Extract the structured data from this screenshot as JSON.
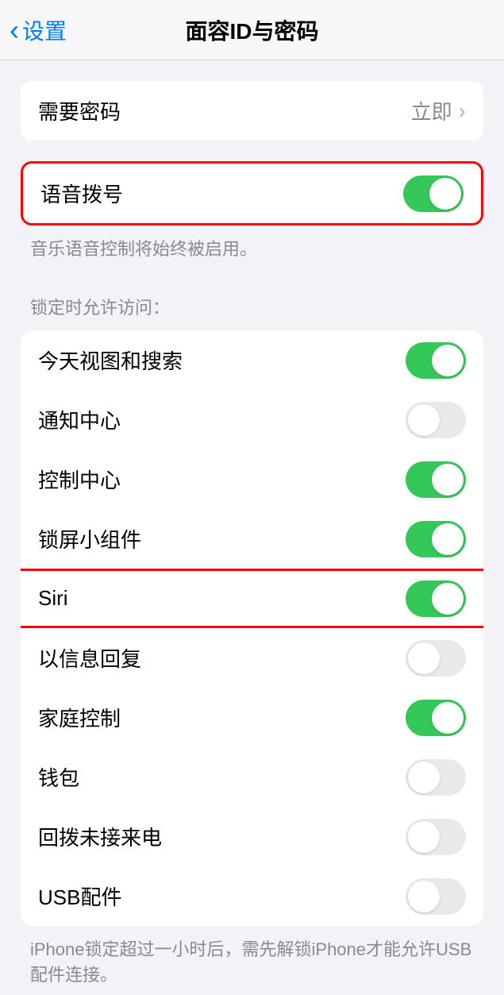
{
  "header": {
    "back_label": "设置",
    "title": "面容ID与密码"
  },
  "passcode": {
    "label": "需要密码",
    "value": "立即"
  },
  "voice_dial": {
    "label": "语音拨号",
    "on": true,
    "note": "音乐语音控制将始终被启用。"
  },
  "lock_section": {
    "header": "锁定时允许访问：",
    "items": [
      {
        "label": "今天视图和搜索",
        "on": true
      },
      {
        "label": "通知中心",
        "on": false
      },
      {
        "label": "控制中心",
        "on": true
      },
      {
        "label": "锁屏小组件",
        "on": true
      },
      {
        "label": "Siri",
        "on": true
      },
      {
        "label": "以信息回复",
        "on": false
      },
      {
        "label": "家庭控制",
        "on": true
      },
      {
        "label": "钱包",
        "on": false
      },
      {
        "label": "回拨未接来电",
        "on": false
      },
      {
        "label": "USB配件",
        "on": false
      }
    ],
    "footer": "iPhone锁定超过一小时后，需先解锁iPhone才能允许USB配件连接。"
  }
}
